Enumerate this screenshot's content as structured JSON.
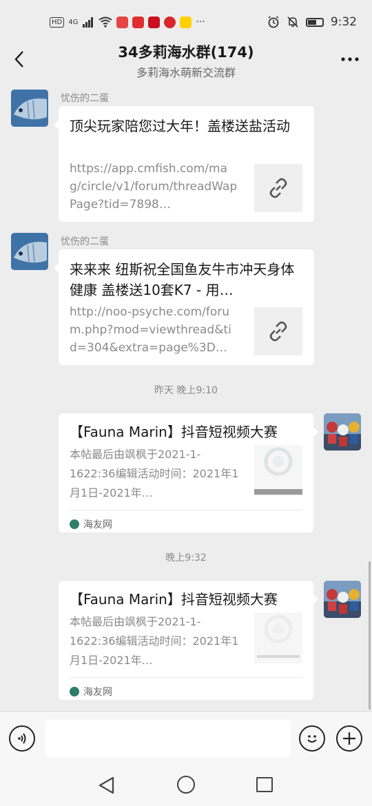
{
  "status_bar": {
    "network_badge": "HD",
    "network": "4G",
    "time": "9:32",
    "more": "···"
  },
  "header": {
    "title": "34多莉海水群(174)",
    "subtitle": "多莉海水萌新交流群"
  },
  "messages": [
    {
      "sender": "忧伤的二蛋",
      "title": "顶尖玩家陪您过大年！盖楼送盐活动",
      "url": "https://app.cmfish.com/mag/circle/v1/forum/threadWapPage?tid=7898…"
    },
    {
      "sender": "忧伤的二蛋",
      "title": "来来来 纽斯祝全国鱼友牛市冲天身体健康 盖楼送10套K7 - 用…",
      "url": "http://noo-psyche.com/forum.php?mod=viewthread&tid=304&extra=page%3D…"
    }
  ],
  "timestamps": [
    "昨天 晚上9:10",
    "晚上9:32"
  ],
  "shared_cards": [
    {
      "title": "【Fauna Marin】抖音短视频大赛",
      "desc": "本帖最后由飒枫于2021-1-1622:36编辑活动时间：2021年1月1日-2021年…",
      "source": "海友网"
    },
    {
      "title": "【Fauna Marin】抖音短视频大赛",
      "desc": "本帖最后由飒枫于2021-1-1622:36编辑活动时间：2021年1月1日-2021年…",
      "source": "海友网"
    }
  ],
  "input_bar": {
    "placeholder": ""
  },
  "colors": {
    "chat_background": "#ededed",
    "bubble": "#ffffff",
    "secondary_text": "#8a8a8a"
  },
  "icons": [
    "back-arrow-icon",
    "more-icon",
    "link-icon",
    "voice-icon",
    "emoji-icon",
    "plus-icon",
    "nav-back-icon",
    "nav-home-icon",
    "nav-recent-icon"
  ]
}
